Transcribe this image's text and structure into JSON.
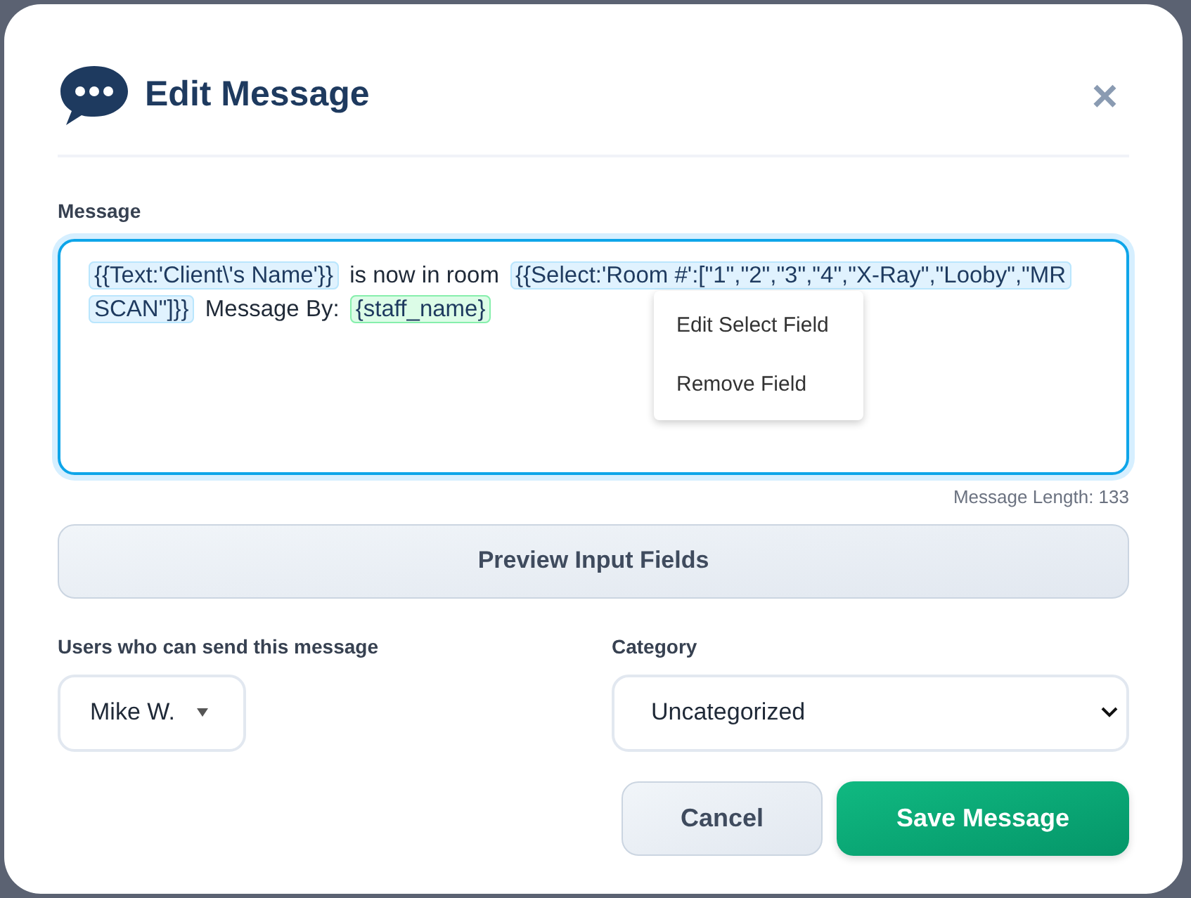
{
  "dialog": {
    "title": "Edit Message",
    "close": "×"
  },
  "message": {
    "label": "Message",
    "segments": [
      {
        "kind": "field",
        "text": "{{Text:'Client\\'s Name'}}"
      },
      {
        "kind": "text",
        "text": "is now in room"
      },
      {
        "kind": "field",
        "text": "{{Select:'Room #':[\"1\",\"2\",\"3\",\"4\",\"X-Ray\",\"Looby\",\"MR SCAN\"]}}"
      },
      {
        "kind": "text",
        "text": "Message By:"
      },
      {
        "kind": "variable",
        "text": "{staff_name}"
      }
    ],
    "context_menu": [
      "Edit Select Field",
      "Remove Field"
    ],
    "length": "Message Length: 133"
  },
  "preview_button": "Preview Input Fields",
  "users": {
    "label": "Users who can send this message",
    "value": "Mike W."
  },
  "category": {
    "label": "Category",
    "value": "Uncategorized"
  },
  "buttons": {
    "cancel": "Cancel",
    "save": "Save Message"
  }
}
